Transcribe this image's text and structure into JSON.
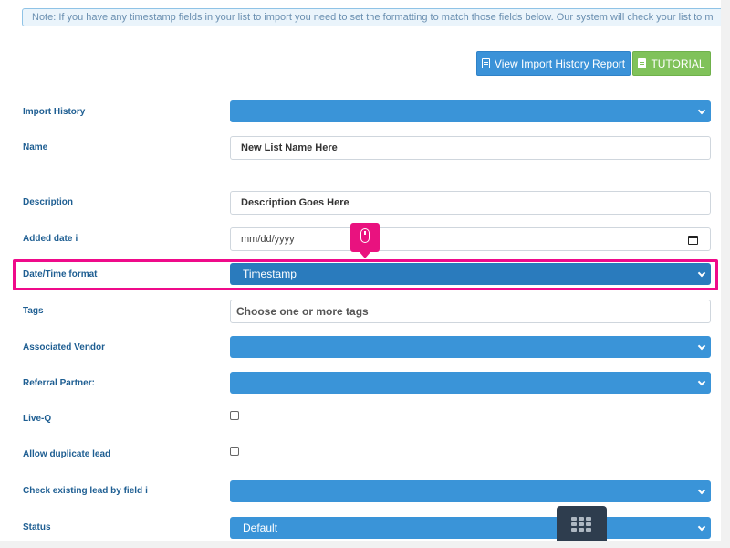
{
  "note": "Note: If you have any timestamp fields in your list to import you need to set the formatting to match those fields below. Our system will check your list to m",
  "buttons": {
    "history": "View Import History Report",
    "tutorial": "TUTORIAL"
  },
  "labels": {
    "import_history": "Import History",
    "name": "Name",
    "description": "Description",
    "added_date": "Added date",
    "datetime_format": "Date/Time format",
    "tags": "Tags",
    "associated_vendor": "Associated Vendor",
    "referral_partner": "Referral Partner:",
    "live_q": "Live-Q",
    "allow_duplicate": "Allow duplicate lead",
    "check_existing": "Check existing lead by field",
    "status": "Status"
  },
  "info_glyph": "i",
  "fields": {
    "name_value": "New List Name Here",
    "description_value": "Description Goes Here",
    "added_date_value": "mm/dd/yyyy",
    "datetime_format_value": "Timestamp",
    "tags_placeholder": "Choose one or more tags",
    "status_value": "Default",
    "live_q_checked": false,
    "allow_duplicate_checked": false
  },
  "colors": {
    "select_blue": "#3a94d8",
    "highlight_pink": "#ef0a8a",
    "label_blue": "#1e5e92",
    "tutorial_green": "#80c25a"
  },
  "icons": {
    "history": "document-icon",
    "tutorial": "file-icon",
    "date": "calendar-icon",
    "cursor": "mouse-icon",
    "menu": "grid-icon"
  }
}
